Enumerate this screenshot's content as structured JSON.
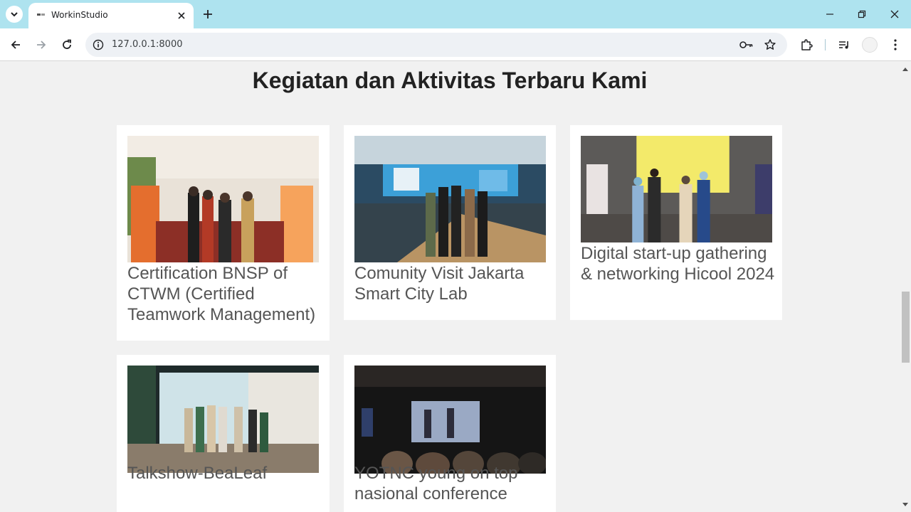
{
  "browser": {
    "tab_title": "WorkinStudio",
    "url": "127.0.0.1:8000"
  },
  "page": {
    "section_title": "Kegiatan dan Aktivitas Terbaru Kami",
    "cards": [
      {
        "caption": "Certification BNSP of CTWM (Certified Teamwork Management)"
      },
      {
        "caption": "Comunity Visit Jakarta Smart City Lab"
      },
      {
        "caption": "Digital start-up gathering & networking Hicool 2024"
      },
      {
        "caption": "Talkshow-BeaLeaf"
      },
      {
        "caption": "YOTNC young on top nasional conference"
      }
    ]
  },
  "colors": {
    "tabbar_bg": "#aee3ef",
    "page_bg": "#f1f1f1",
    "card_bg": "#ffffff",
    "caption_text": "#555555",
    "title_text": "#222222"
  }
}
